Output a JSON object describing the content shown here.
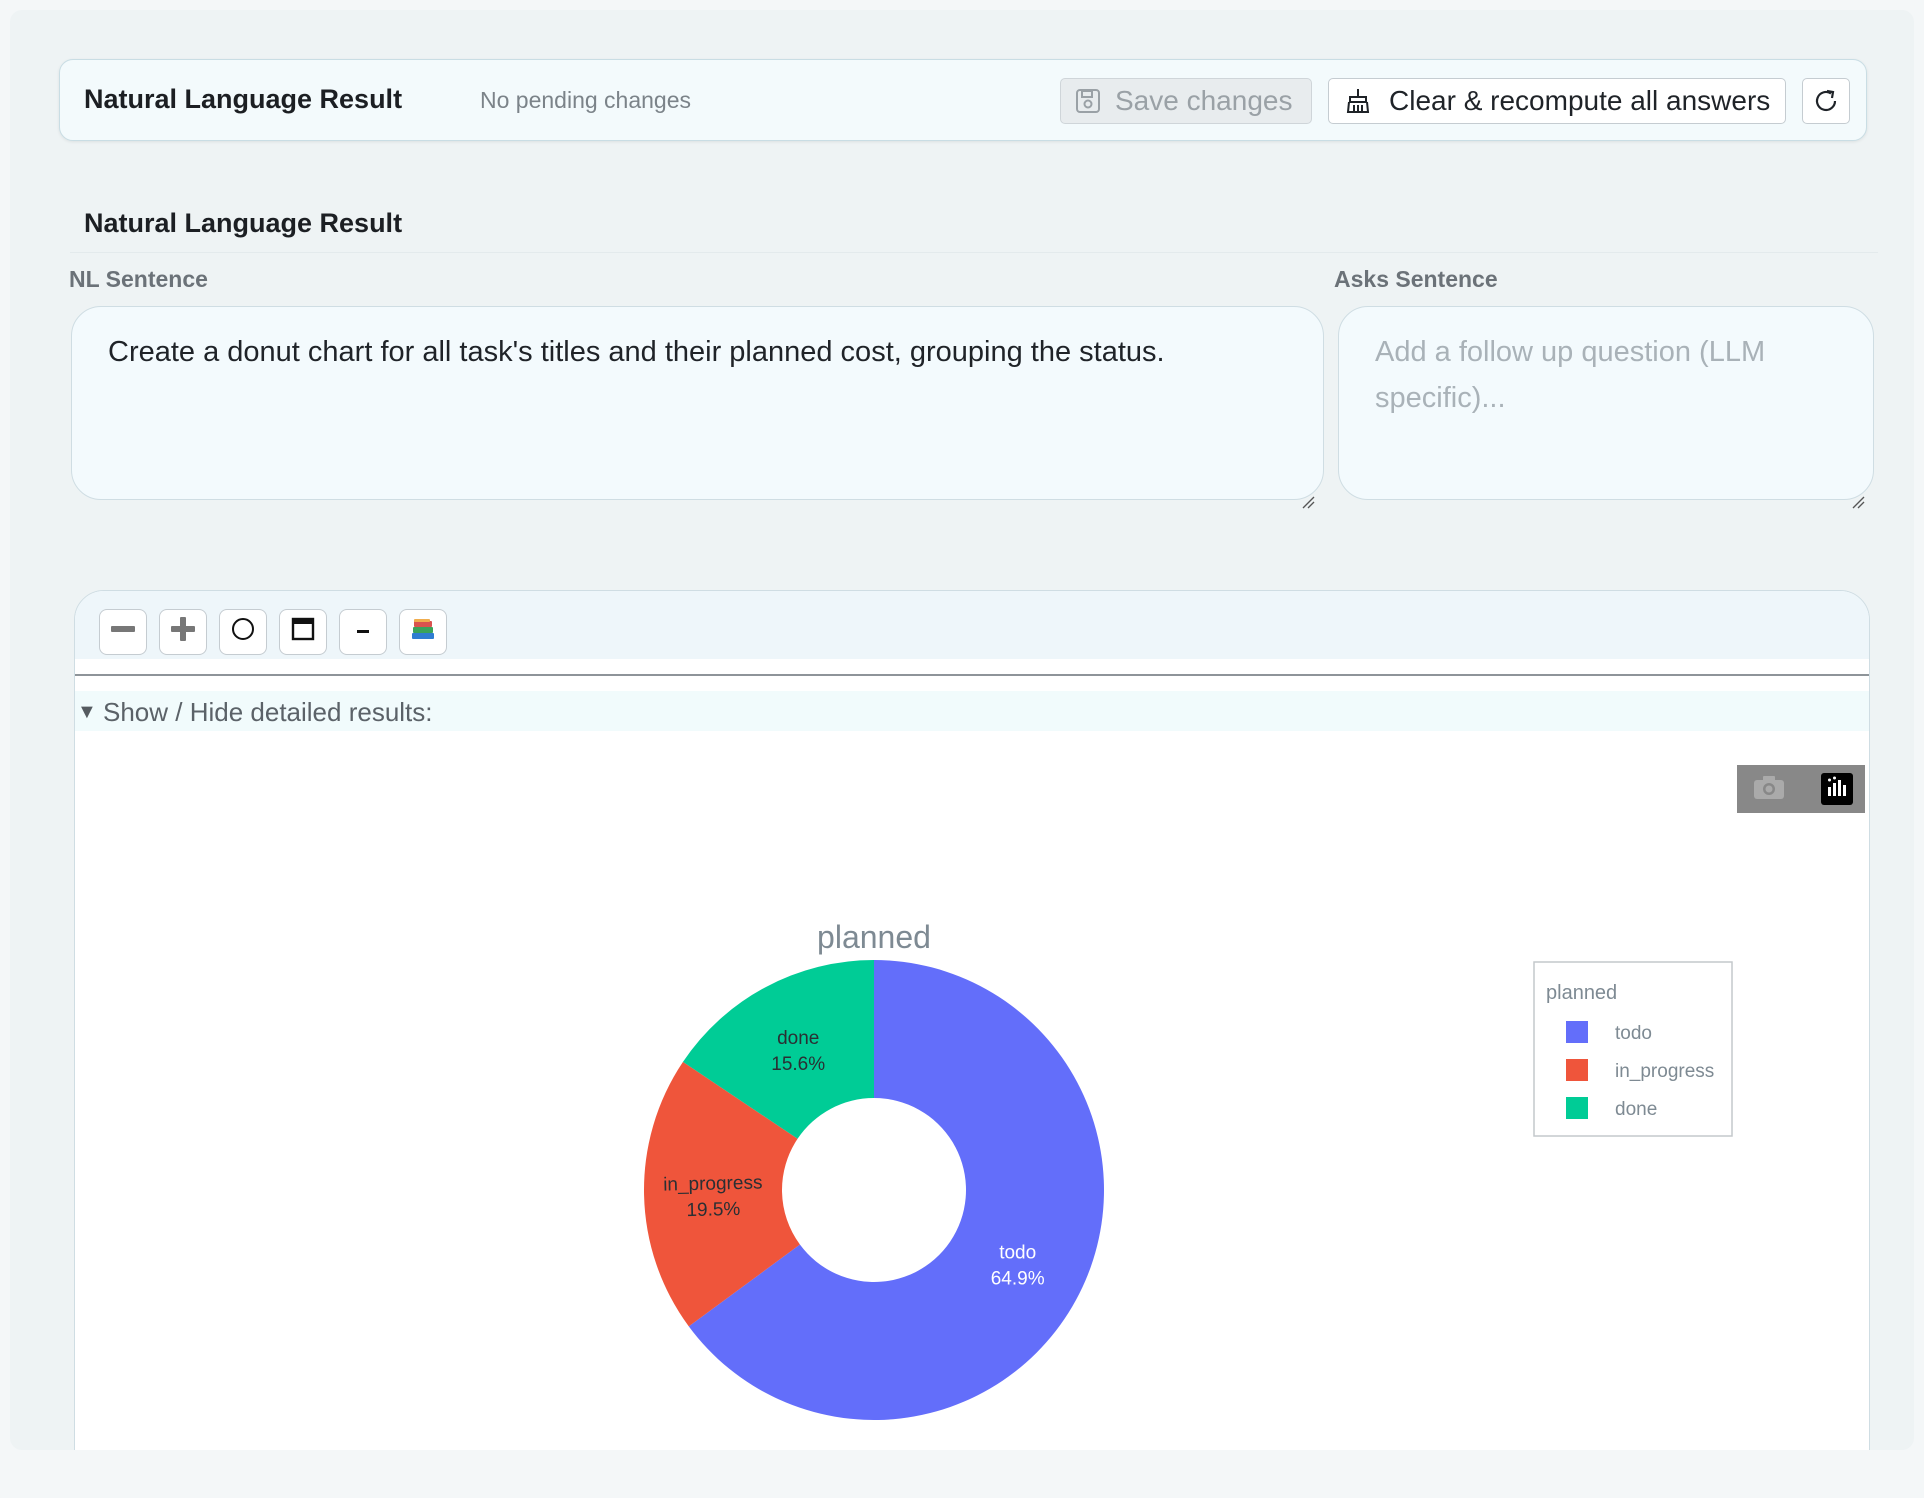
{
  "header": {
    "title": "Natural Language Result",
    "status": "No pending changes",
    "save_label": "Save changes",
    "clear_label": "Clear & recompute all answers"
  },
  "section": {
    "title": "Natural Language Result",
    "nl_label": "NL Sentence",
    "nl_value": "Create a donut chart for all task's titles and their planned cost, grouping the status.",
    "asks_label": "Asks Sentence",
    "asks_placeholder": "Add a follow up question (LLM specific)..."
  },
  "toolbar": {
    "icons": [
      "minus-bold-icon",
      "plus-bold-icon",
      "circle-icon",
      "window-icon",
      "minus-icon",
      "books-icon"
    ]
  },
  "details": {
    "toggle_label": "Show / Hide detailed results:"
  },
  "colors": {
    "todo": "#636efa",
    "in_progress": "#ef553b",
    "done": "#00cc96"
  },
  "chart_data": {
    "type": "pie",
    "hole": 0.4,
    "title": "planned",
    "legend_title": "planned",
    "legend_position": "right",
    "labels": [
      "todo",
      "in_progress",
      "done"
    ],
    "values": [
      64.9,
      19.5,
      15.6
    ],
    "percent_labels": [
      "64.9%",
      "19.5%",
      "15.6%"
    ]
  }
}
